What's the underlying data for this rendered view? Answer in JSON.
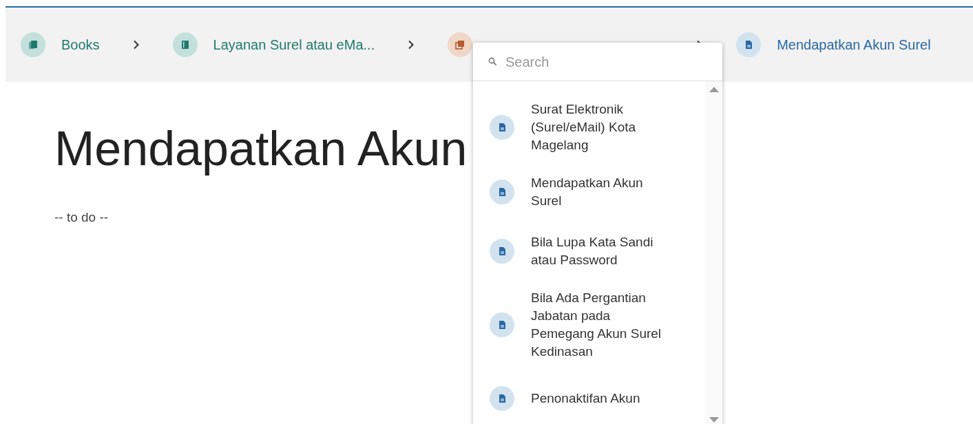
{
  "breadcrumbs": [
    {
      "kind": "bookshelf",
      "label": "Books"
    },
    {
      "kind": "book",
      "label": "Layanan Surel atau eMa..."
    },
    {
      "kind": "chapter"
    },
    {
      "kind": "page",
      "label": "Mendapatkan Akun Surel"
    }
  ],
  "page": {
    "title": "Mendapatkan Akun",
    "body": "-- to do --"
  },
  "dropdown": {
    "placeholder": "Search",
    "items": [
      {
        "kind": "page",
        "label": "Surat Elektronik (Surel/eMail) Kota Magelang"
      },
      {
        "kind": "page",
        "label": "Mendapatkan Akun Surel"
      },
      {
        "kind": "page",
        "label": "Bila Lupa Kata Sandi atau Password"
      },
      {
        "kind": "page",
        "label": "Bila Ada Pergantian Jabatan pada Pemegang Akun Surel Kedinasan"
      },
      {
        "kind": "page",
        "label": "Penonaktifan Akun"
      }
    ]
  }
}
